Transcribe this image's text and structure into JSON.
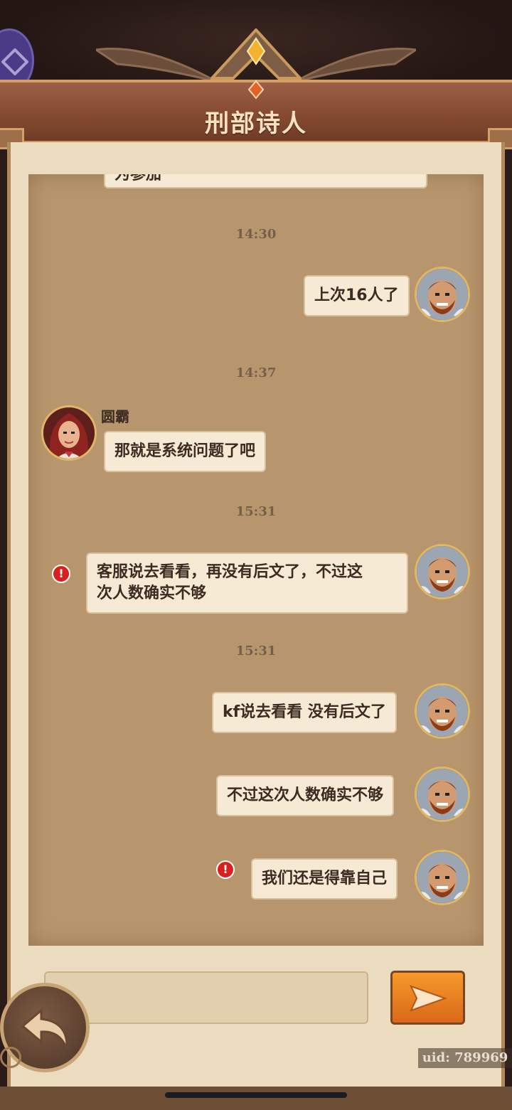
{
  "header": {
    "title": "刑部诗人"
  },
  "chat": {
    "partial_top_message": "为参加",
    "timestamps": [
      "14:30",
      "14:37",
      "15:31",
      "15:31"
    ],
    "messages": [
      {
        "side": "right",
        "text": "上次16人了"
      },
      {
        "side": "left",
        "sender": "圆霸",
        "text": "那就是系统问题了吧"
      },
      {
        "side": "right",
        "failed": true,
        "line1": "客服说去看看，再没有后文了，不过这",
        "line2": "次人数确实不够"
      },
      {
        "side": "right",
        "text": "kf说去看看 没有后文了"
      },
      {
        "side": "right",
        "text": "不过这次人数确实不够"
      },
      {
        "side": "right",
        "failed": true,
        "text": "我们还是得靠自己"
      }
    ]
  },
  "footer": {
    "input_placeholder": "",
    "uid": "uid: 789969"
  },
  "colors": {
    "parchment": "#ecdcbf",
    "chat_background": "#b8966d",
    "bubble": "#f6ead4",
    "title_bar": "#8e5238",
    "send_button": "#f08a22",
    "alert": "#d9201e"
  },
  "icons": [
    "hero-avatar-icon",
    "heroine-avatar-icon",
    "alert-icon",
    "send-arrow-icon",
    "back-arrow-icon",
    "ship-wheel-icon",
    "gem-icon"
  ]
}
